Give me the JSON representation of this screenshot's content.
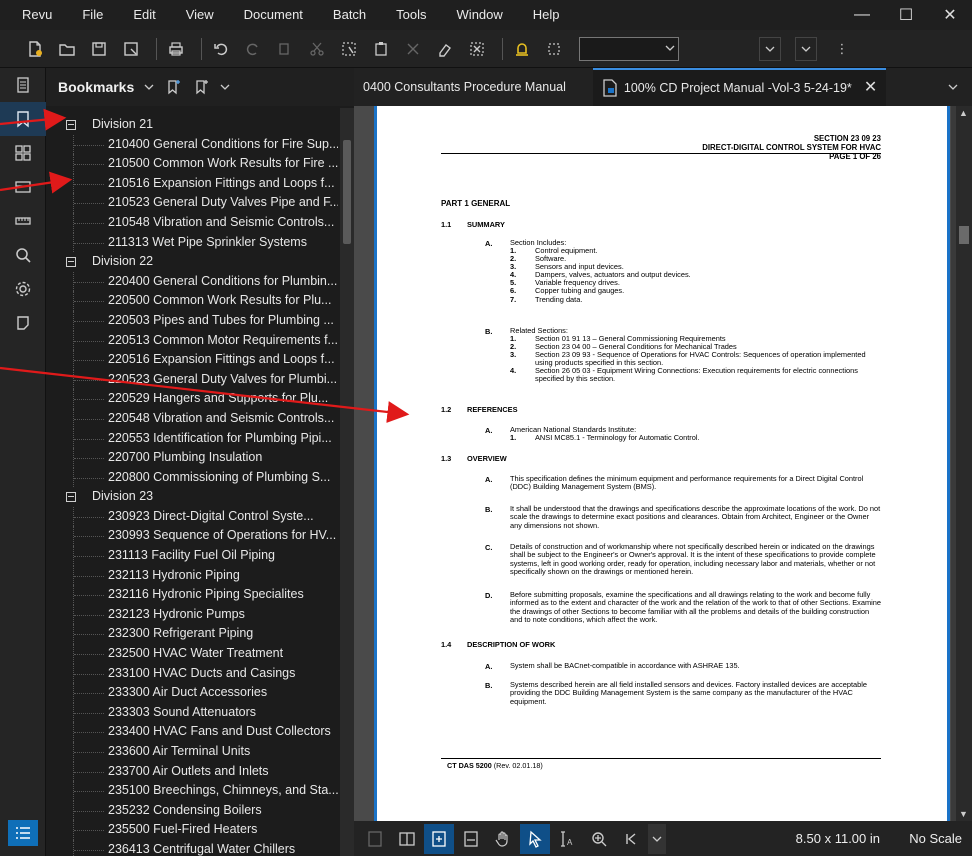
{
  "menu": [
    "Revu",
    "File",
    "Edit",
    "View",
    "Document",
    "Batch",
    "Tools",
    "Window",
    "Help"
  ],
  "window_controls": [
    "—",
    "☐",
    "✕"
  ],
  "bookmarks": {
    "title": "Bookmarks",
    "tree": [
      {
        "type": "division",
        "label": "Division 21"
      },
      {
        "type": "child",
        "label": "210400 General Conditions for Fire Sup..."
      },
      {
        "type": "child",
        "label": "210500 Common Work Results for Fire ..."
      },
      {
        "type": "child",
        "label": "210516 Expansion Fittings and Loops f..."
      },
      {
        "type": "child",
        "label": "210523 General Duty Valves Pipe and F..."
      },
      {
        "type": "child",
        "label": "210548 Vibration and Seismic Controls..."
      },
      {
        "type": "child",
        "label": "211313 Wet Pipe Sprinkler Systems"
      },
      {
        "type": "division",
        "label": "Division 22"
      },
      {
        "type": "child",
        "label": "220400 General Conditions for Plumbin..."
      },
      {
        "type": "child",
        "label": "220500 Common Work Results for Plu..."
      },
      {
        "type": "child",
        "label": "220503 Pipes and Tubes for Plumbing ..."
      },
      {
        "type": "child",
        "label": "220513 Common Motor Requirements f..."
      },
      {
        "type": "child",
        "label": "220516 Expansion Fittings and Loops f..."
      },
      {
        "type": "child",
        "label": "220523 General Duty Valves for Plumbi..."
      },
      {
        "type": "child",
        "label": "220529 Hangers and Supports for Plu..."
      },
      {
        "type": "child",
        "label": "220548 Vibration and Seismic Controls..."
      },
      {
        "type": "child",
        "label": "220553 Identification for Plumbing Pipi..."
      },
      {
        "type": "child",
        "label": "220700 Plumbing Insulation"
      },
      {
        "type": "child",
        "label": "220800 Commissioning of Plumbing S..."
      },
      {
        "type": "division",
        "label": "Division 23"
      },
      {
        "type": "child",
        "label": "230923 Direct-Digital Control Syste..."
      },
      {
        "type": "child",
        "label": "230993 Sequence of Operations for HV..."
      },
      {
        "type": "child",
        "label": "231113 Facility Fuel Oil Piping"
      },
      {
        "type": "child",
        "label": "232113 Hydronic Piping"
      },
      {
        "type": "child",
        "label": "232116 Hydronic Piping Specialites"
      },
      {
        "type": "child",
        "label": "232123 Hydronic Pumps"
      },
      {
        "type": "child",
        "label": "232300 Refrigerant Piping"
      },
      {
        "type": "child",
        "label": "232500 HVAC Water Treatment"
      },
      {
        "type": "child",
        "label": "233100 HVAC Ducts and Casings"
      },
      {
        "type": "child",
        "label": "233300 Air Duct Accessories"
      },
      {
        "type": "child",
        "label": "233303 Sound Attenuators"
      },
      {
        "type": "child",
        "label": "233400 HVAC Fans and Dust Collectors"
      },
      {
        "type": "child",
        "label": "233600 Air Terminal Units"
      },
      {
        "type": "child",
        "label": "233700 Air Outlets and Inlets"
      },
      {
        "type": "child",
        "label": "235100 Breechings, Chimneys, and Sta..."
      },
      {
        "type": "child",
        "label": "235232 Condensing Boilers"
      },
      {
        "type": "child",
        "label": "235500 Fuel-Fired Heaters"
      },
      {
        "type": "child",
        "label": "236413 Centrifugal Water Chillers"
      }
    ]
  },
  "tabs": [
    {
      "label": "0400 Consultants Procedure Manual",
      "active": false
    },
    {
      "label": "100% CD Project Manual -Vol-3  5-24-19*",
      "active": true
    }
  ],
  "doc": {
    "header": [
      "SECTION 23 09 23",
      "DIRECT-DIGITAL CONTROL SYSTEM FOR HVAC",
      "PAGE 1 OF 26"
    ],
    "part": "PART 1 GENERAL",
    "s11": {
      "num": "1.1",
      "title": "SUMMARY"
    },
    "s11A": {
      "letter": "A.",
      "text": "Section Includes:",
      "items": [
        [
          "1.",
          "Control equipment."
        ],
        [
          "2.",
          "Software."
        ],
        [
          "3.",
          "Sensors and input devices."
        ],
        [
          "4.",
          "Dampers, valves, actuators and output devices."
        ],
        [
          "5.",
          "Variable frequency drives."
        ],
        [
          "6.",
          "Copper tubing and gauges."
        ],
        [
          "7.",
          "Trending data."
        ]
      ]
    },
    "s11B": {
      "letter": "B.",
      "text": "Related Sections:",
      "items": [
        [
          "1.",
          "Section 01 91 13 – General Commissioning Requirements"
        ],
        [
          "2.",
          "Section 23 04 00 – General Conditions for Mechanical Trades"
        ],
        [
          "3.",
          "Section 23 09 93 - Sequence of Operations for HVAC Controls: Sequences of operation implemented using products specified in this section."
        ],
        [
          "4.",
          "Section 26 05 03 - Equipment Wiring Connections: Execution requirements for electric connections specified by this section."
        ]
      ]
    },
    "s12": {
      "num": "1.2",
      "title": "REFERENCES"
    },
    "s12A": {
      "letter": "A.",
      "text": "American National Standards Institute:",
      "items": [
        [
          "1.",
          "ANSI MC85.1 - Terminology for Automatic Control."
        ]
      ]
    },
    "s13": {
      "num": "1.3",
      "title": "OVERVIEW"
    },
    "s13A": {
      "letter": "A.",
      "text": "This specification defines the minimum equipment and performance requirements for a Direct Digital Control (DDC) Building Management System (BMS)."
    },
    "s13B": {
      "letter": "B.",
      "text": "It shall be understood that the drawings and specifications describe the approximate locations of the work.  Do not scale the drawings to determine exact positions and clearances.  Obtain from Architect, Engineer or the Owner any dimensions not shown."
    },
    "s13C": {
      "letter": "C.",
      "text": "Details of construction and of workmanship where not specifically described herein or indicated on the drawings shall be subject to the Engineer's or Owner's approval.  It is the intent of these specifications to provide complete systems, left in good working order, ready for operation, including necessary labor and materials, whether or not specifically shown on the drawings or mentioned herein."
    },
    "s13D": {
      "letter": "D.",
      "text": "Before submitting proposals, examine the specifications and all drawings relating to the work and become fully informed as to the extent and character of the work and the relation of the work to that of other Sections.  Examine the drawings of other Sections to become familiar with all the problems and details of the building construction and to note conditions, which affect the work."
    },
    "s14": {
      "num": "1.4",
      "title": "DESCRIPTION OF WORK"
    },
    "s14A": {
      "letter": "A.",
      "text": "System shall be BACnet-compatible in accordance with ASHRAE 135."
    },
    "s14B": {
      "letter": "B.",
      "text": "Systems described herein are all field installed sensors and devices.  Factory installed devices are acceptable providing the DDC Building Management System is the same company as the manufacturer of the HVAC equipment."
    },
    "footer_bold": "CT DAS 5200",
    "footer_rest": " (Rev. 02.01.18)"
  },
  "status": {
    "page_size": "8.50 x 11.00 in",
    "scale": "No Scale"
  },
  "colors": {
    "accent": "#1a73c8",
    "arrow": "#e01a1a"
  }
}
